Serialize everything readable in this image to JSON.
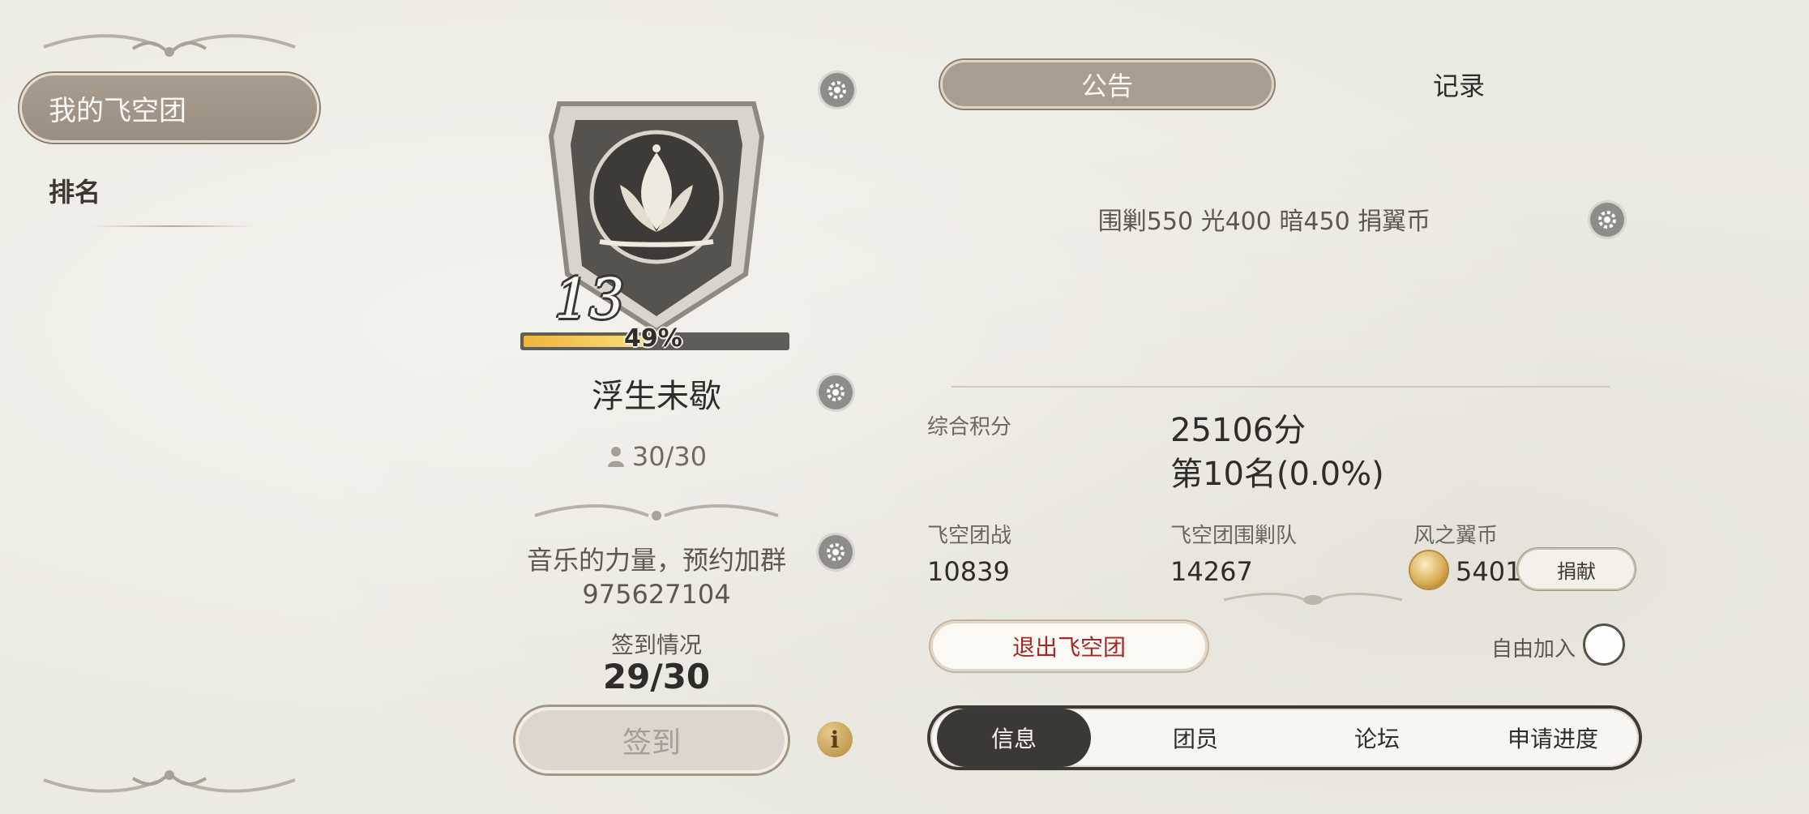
{
  "sidebar": {
    "items": [
      {
        "label": "我的飞空团",
        "active": true
      },
      {
        "label": "排名",
        "active": false
      }
    ]
  },
  "guild": {
    "level": "13",
    "progress_percent": 49,
    "progress_label": "49%",
    "name": "浮生未歇",
    "members": "30/30",
    "description_line1": "音乐的力量，预约加群",
    "description_line2": "975627104",
    "signin_label": "签到情况",
    "signin_value": "29/30",
    "signin_button": "签到"
  },
  "tabs": {
    "announcement": "公告",
    "records": "记录"
  },
  "announcement_text": "围剿550 光400 暗450 捐翼币",
  "stats": {
    "total_score_label": "综合积分",
    "total_score_value": "25106分",
    "rank_value": "第10名(0.0%)",
    "airship_battle_label": "飞空团战",
    "airship_battle_value": "10839",
    "siege_team_label": "飞空团围剿队",
    "siege_team_value": "14267",
    "wind_coin_label": "风之翼币",
    "wind_coin_value": "5401",
    "donate_button": "捐献"
  },
  "actions": {
    "exit_button": "退出飞空团",
    "free_join_label": "自由加入"
  },
  "bottom_tabs": [
    {
      "label": "信息",
      "active": true
    },
    {
      "label": "团员",
      "active": false
    },
    {
      "label": "论坛",
      "active": false
    },
    {
      "label": "申请进度",
      "active": false
    }
  ],
  "colors": {
    "background": "#ecebe3",
    "accent_tab": "#a99d8f",
    "exit_text": "#a3282a",
    "xp_fill": "#f0b33e"
  },
  "icons": [
    "gear-icon",
    "info-icon",
    "member-icon",
    "coin-icon",
    "guild-emblem"
  ]
}
